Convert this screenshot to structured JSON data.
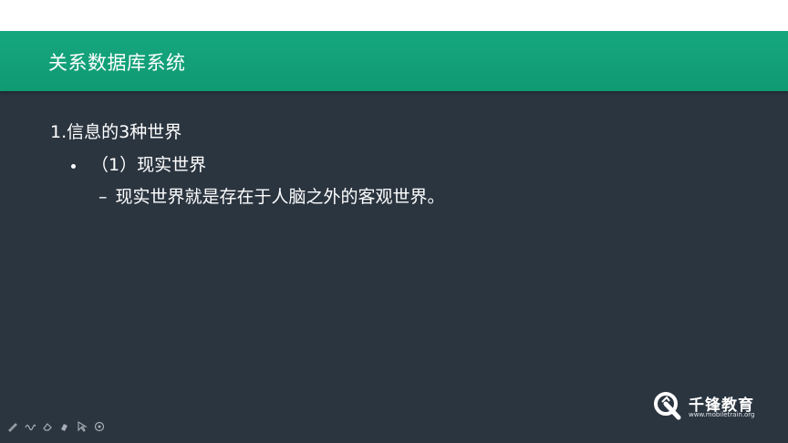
{
  "slide": {
    "title": "关系数据库系统",
    "heading": "1.信息的3种世界",
    "bullet": "（1）现实世界",
    "sub_dash": "–",
    "sub_text": "现实世界就是存在于人脑之外的客观世界。"
  },
  "logo": {
    "name": "千锋教育",
    "url": "www.mobiletrain.org"
  },
  "toolbar": {
    "tools": [
      "pen-icon",
      "wave-icon",
      "eraser-icon",
      "highlighter-icon",
      "pointer-icon",
      "circle-icon"
    ]
  },
  "colors": {
    "background": "#2b3540",
    "title_bar": "#13a27a",
    "text": "#ffffff"
  }
}
